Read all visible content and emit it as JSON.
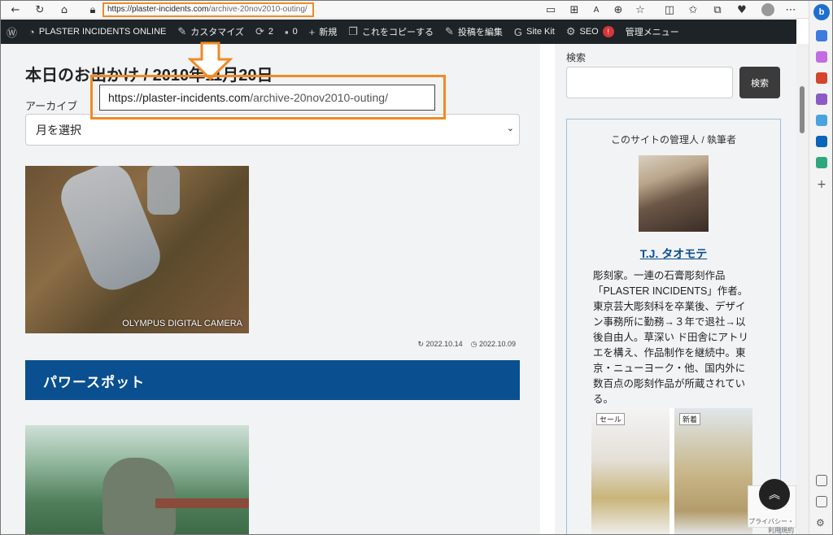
{
  "browser": {
    "url_domain": "https://plaster-incidents.com",
    "url_path": "/archive-20nov2010-outing/"
  },
  "adminbar": {
    "site_name": "PLASTER INCIDENTS ONLINE",
    "customize": "カスタマイズ",
    "updates_count": "2",
    "comments_count": "0",
    "new": "新規",
    "copy": "これをコピーする",
    "edit": "投稿を編集",
    "sitekit": "Site Kit",
    "seo": "SEO",
    "seo_badge": "!",
    "menu": "管理メニュー"
  },
  "main": {
    "title": "本日のお出かけ / 2010年11月20日",
    "archive_label": "アーカイブ",
    "archive_select": "月を選択",
    "callout_domain": "https://plaster-incidents.com",
    "callout_path": "/archive-20nov2010-outing/",
    "photo_caption": "OLYMPUS DIGITAL CAMERA",
    "updated_date": "2022.10.14",
    "published_date": "2022.10.09",
    "section_heading": "パワースポット"
  },
  "sidebar": {
    "search_label": "検索",
    "search_button": "検索",
    "admin_heading": "このサイトの管理人 / 執筆者",
    "author_name": "T.J. タオモテ",
    "author_bio": "彫刻家。一連の石膏彫刻作品「PLASTER INCIDENTS」作者。東京芸大彫刻科を卒業後、デザイン事務所に勤務→３年で退社→以後自由人。草深い ド田舎にアトリエを構え、作品制作を継続中。東京・ニューヨーク・他、国内外に数百点の彫刻作品が所蔵されている。",
    "ad_tag_sale": "セール",
    "ad_tag_new": "新着"
  },
  "recaptcha": "プライバシー・利用規約",
  "colors": {
    "accent_orange": "#f08a24",
    "section_blue": "#0a4f8f",
    "admin_bar": "#1d2327"
  }
}
